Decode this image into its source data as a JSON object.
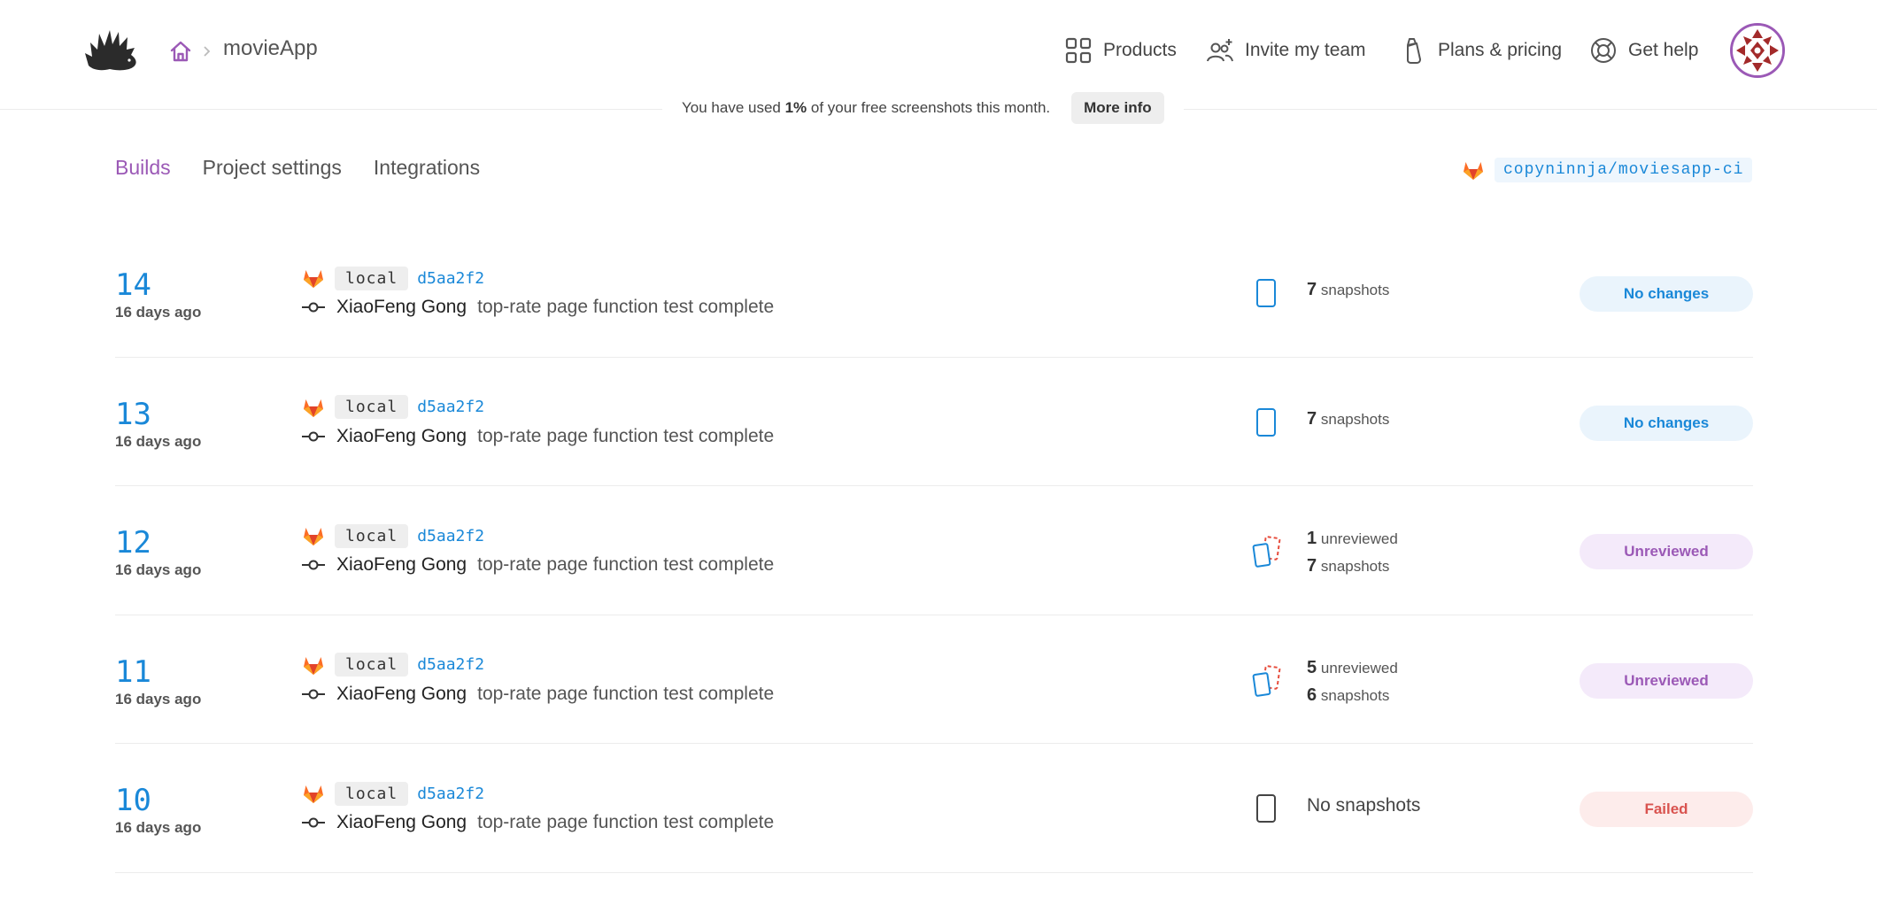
{
  "breadcrumb": {
    "project": "movieApp"
  },
  "nav": {
    "products": "Products",
    "invite": "Invite my team",
    "plans": "Plans & pricing",
    "help": "Get help"
  },
  "usage": {
    "text_before": "You have used ",
    "percent": "1%",
    "text_after": " of your free screenshots this month.",
    "button": "More info"
  },
  "tabs": [
    "Builds",
    "Project settings",
    "Integrations"
  ],
  "repo": "copyninnja/moviesapp-ci",
  "builds": [
    {
      "number": "14",
      "age": "16 days ago",
      "branch": "local",
      "sha": "d5aa2f2",
      "author": "XiaoFeng Gong",
      "message": "top-rate page function test complete",
      "unreviewed_count": "",
      "unreviewed_label": "",
      "snapshot_count": "7",
      "snapshot_label": "snapshots",
      "none_label": "",
      "status": "No changes"
    },
    {
      "number": "13",
      "age": "16 days ago",
      "branch": "local",
      "sha": "d5aa2f2",
      "author": "XiaoFeng Gong",
      "message": "top-rate page function test complete",
      "unreviewed_count": "",
      "unreviewed_label": "",
      "snapshot_count": "7",
      "snapshot_label": "snapshots",
      "none_label": "",
      "status": "No changes"
    },
    {
      "number": "12",
      "age": "16 days ago",
      "branch": "local",
      "sha": "d5aa2f2",
      "author": "XiaoFeng Gong",
      "message": "top-rate page function test complete",
      "unreviewed_count": "1",
      "unreviewed_label": "unreviewed",
      "snapshot_count": "7",
      "snapshot_label": "snapshots",
      "none_label": "",
      "status": "Unreviewed"
    },
    {
      "number": "11",
      "age": "16 days ago",
      "branch": "local",
      "sha": "d5aa2f2",
      "author": "XiaoFeng Gong",
      "message": "top-rate page function test complete",
      "unreviewed_count": "5",
      "unreviewed_label": "unreviewed",
      "snapshot_count": "6",
      "snapshot_label": "snapshots",
      "none_label": "",
      "status": "Unreviewed"
    },
    {
      "number": "10",
      "age": "16 days ago",
      "branch": "local",
      "sha": "d5aa2f2",
      "author": "XiaoFeng Gong",
      "message": "top-rate page function test complete",
      "unreviewed_count": "",
      "unreviewed_label": "",
      "snapshot_count": "",
      "snapshot_label": "",
      "none_label": "No snapshots",
      "status": "Failed"
    }
  ],
  "colors": {
    "accent": "#9b59b6",
    "link": "#1a88d8",
    "failed": "#d9534f"
  },
  "icons": {
    "logo": "hedgehog-logo-icon",
    "home": "home-icon",
    "products": "grid-icon",
    "invite": "add-user-icon",
    "plans": "baby-bottle-icon",
    "help": "lifebuoy-icon",
    "gitlab": "gitlab-icon",
    "commit": "git-commit-icon",
    "snapshot": "device-icon",
    "unreviewed": "diff-icon"
  }
}
